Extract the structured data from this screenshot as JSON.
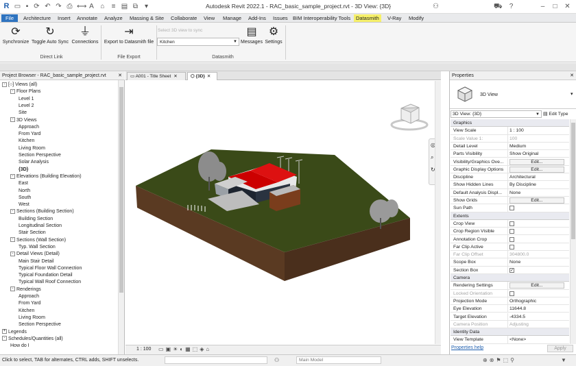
{
  "window": {
    "title": "Autodesk Revit 2022.1 - RAC_basic_sample_project.rvt - 3D View: {3D}"
  },
  "menu": [
    "File",
    "Architecture",
    "Insert",
    "Annotate",
    "Analyze",
    "Massing & Site",
    "Collaborate",
    "View",
    "Manage",
    "Add-Ins",
    "Issues",
    "BIM Interoperability Tools",
    "Datasmith",
    "V-Ray",
    "Modify"
  ],
  "ribbon": {
    "buttons": [
      "Synchronize",
      "Toggle Auto Sync",
      "Connections",
      "Export to Datasmith file",
      "Messages",
      "Settings"
    ],
    "sync_placeholder": "Select 3D view to sync",
    "view_select_value": "Kitchen",
    "groups": [
      "Direct Link",
      "File Export",
      "Datasmith"
    ]
  },
  "project_browser": {
    "title": "Project Browser - RAC_basic_sample_project.rvt",
    "rows": [
      {
        "t": "[○] Views (all)",
        "d": 0,
        "tog": "-"
      },
      {
        "t": "Floor Plans",
        "d": 1,
        "tog": "-"
      },
      {
        "t": "Level 1",
        "d": 2
      },
      {
        "t": "Level 2",
        "d": 2
      },
      {
        "t": "Site",
        "d": 2
      },
      {
        "t": "3D Views",
        "d": 1,
        "tog": "-"
      },
      {
        "t": "Approach",
        "d": 2
      },
      {
        "t": "From Yard",
        "d": 2
      },
      {
        "t": "Kitchen",
        "d": 2
      },
      {
        "t": "Living Room",
        "d": 2
      },
      {
        "t": "Section Perspective",
        "d": 2
      },
      {
        "t": "Solar Analysis",
        "d": 2
      },
      {
        "t": "{3D}",
        "d": 2,
        "sel": true
      },
      {
        "t": "Elevations (Building Elevation)",
        "d": 1,
        "tog": "-"
      },
      {
        "t": "East",
        "d": 2
      },
      {
        "t": "North",
        "d": 2
      },
      {
        "t": "South",
        "d": 2
      },
      {
        "t": "West",
        "d": 2
      },
      {
        "t": "Sections (Building Section)",
        "d": 1,
        "tog": "-"
      },
      {
        "t": "Building Section",
        "d": 2
      },
      {
        "t": "Longitudinal Section",
        "d": 2
      },
      {
        "t": "Stair Section",
        "d": 2
      },
      {
        "t": "Sections (Wall Section)",
        "d": 1,
        "tog": "-"
      },
      {
        "t": "Typ. Wall Section",
        "d": 2
      },
      {
        "t": "Detail Views (Detail)",
        "d": 1,
        "tog": "-"
      },
      {
        "t": "Main Stair Detail",
        "d": 2
      },
      {
        "t": "Typical Floor Wall Connection",
        "d": 2
      },
      {
        "t": "Typical Foundation Detail",
        "d": 2
      },
      {
        "t": "Typical Wall Roof Connection",
        "d": 2
      },
      {
        "t": "Renderings",
        "d": 1,
        "tog": "-"
      },
      {
        "t": "Approach",
        "d": 2
      },
      {
        "t": "From Yard",
        "d": 2
      },
      {
        "t": "Kitchen",
        "d": 2
      },
      {
        "t": "Living Room",
        "d": 2
      },
      {
        "t": "Section Perspective",
        "d": 2
      },
      {
        "t": "Legends",
        "d": 0,
        "tog": "+"
      },
      {
        "t": "Schedules/Quantities (all)",
        "d": 0,
        "tog": "-"
      },
      {
        "t": "How do I",
        "d": 1
      }
    ]
  },
  "tabs": [
    "A001 - Title Sheet",
    "{3D}"
  ],
  "viewbar": {
    "scale": "1 : 100"
  },
  "properties": {
    "title": "Properties",
    "type_name": "3D View",
    "selector": "3D View: {3D}",
    "edit_type": "Edit Type",
    "rows": [
      {
        "cat": "Graphics"
      },
      {
        "k": "View Scale",
        "v": "1 : 100"
      },
      {
        "k": "Scale Value    1:",
        "v": "100",
        "gray": true
      },
      {
        "k": "Detail Level",
        "v": "Medium"
      },
      {
        "k": "Parts Visibility",
        "v": "Show Original"
      },
      {
        "k": "Visibility/Graphics Ove...",
        "btn": "Edit..."
      },
      {
        "k": "Graphic Display Options",
        "btn": "Edit..."
      },
      {
        "k": "Discipline",
        "v": "Architectural"
      },
      {
        "k": "Show Hidden Lines",
        "v": "By Discipline"
      },
      {
        "k": "Default Analysis Displ...",
        "v": "None"
      },
      {
        "k": "Show Grids",
        "btn": "Edit..."
      },
      {
        "k": "Sun Path",
        "cb": false
      },
      {
        "cat": "Extents"
      },
      {
        "k": "Crop View",
        "cb": false
      },
      {
        "k": "Crop Region Visible",
        "cb": false
      },
      {
        "k": "Annotation Crop",
        "cb": false
      },
      {
        "k": "Far Clip Active",
        "cb": false
      },
      {
        "k": "Far Clip Offset",
        "v": "304800.0",
        "gray": true
      },
      {
        "k": "Scope Box",
        "v": "None"
      },
      {
        "k": "Section Box",
        "cb": true
      },
      {
        "cat": "Camera"
      },
      {
        "k": "Rendering Settings",
        "btn": "Edit..."
      },
      {
        "k": "Locked Orientation",
        "cb": false,
        "gray": true
      },
      {
        "k": "Projection Mode",
        "v": "Orthographic"
      },
      {
        "k": "Eye Elevation",
        "v": "11644.8"
      },
      {
        "k": "Target Elevation",
        "v": "-4334.5"
      },
      {
        "k": "Camera Position",
        "v": "Adjusting",
        "gray": true
      },
      {
        "cat": "Identity Data"
      },
      {
        "k": "View Template",
        "v": "<None>"
      }
    ],
    "help_link": "Properties help",
    "apply": "Apply"
  },
  "status": {
    "hint": "Click to select, TAB for alternates, CTRL adds, SHIFT unselects.",
    "model": "Main Model"
  },
  "colors": {
    "file_blue": "#2f74c0",
    "datasmith_highlight": "#f6f06a",
    "terrain_top": "#3a4a18",
    "terrain_side": "#5a3a22",
    "roof": "#cc0000"
  }
}
